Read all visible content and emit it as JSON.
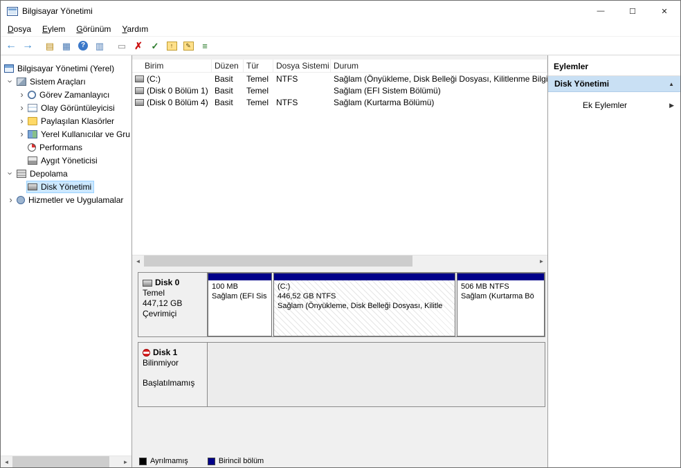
{
  "window": {
    "title": "Bilgisayar Yönetimi",
    "controls": {
      "minimize": "—",
      "maximize": "☐",
      "close": "✕"
    }
  },
  "menu": {
    "items": [
      {
        "label": "Dosya"
      },
      {
        "label": "Eylem"
      },
      {
        "label": "Görünüm"
      },
      {
        "label": "Yardım"
      }
    ]
  },
  "toolbar": {
    "icons": [
      {
        "name": "back",
        "glyph": "←"
      },
      {
        "name": "forward",
        "glyph": "→"
      },
      {
        "name": "show-console-tree",
        "glyph": "▤"
      },
      {
        "name": "export-list",
        "glyph": "▦"
      },
      {
        "name": "help",
        "glyph": "?"
      },
      {
        "name": "show-action-pane",
        "glyph": "▥"
      },
      {
        "name": "status-popup",
        "glyph": "▭"
      },
      {
        "name": "delete-volume",
        "glyph": "✗"
      },
      {
        "name": "mark-active",
        "glyph": "✓"
      },
      {
        "name": "open",
        "glyph": "↑"
      },
      {
        "name": "explore",
        "glyph": "✎"
      },
      {
        "name": "properties",
        "glyph": "≡"
      }
    ]
  },
  "tree": {
    "items": [
      {
        "label": "Bilgisayar Yönetimi (Yerel)"
      },
      {
        "label": "Sistem Araçları"
      },
      {
        "label": "Görev Zamanlayıcı"
      },
      {
        "label": "Olay Görüntüleyicisi"
      },
      {
        "label": "Paylaşılan Klasörler"
      },
      {
        "label": "Yerel Kullanıcılar ve Gru"
      },
      {
        "label": "Performans"
      },
      {
        "label": "Aygıt Yöneticisi"
      },
      {
        "label": "Depolama"
      },
      {
        "label": "Disk Yönetimi"
      },
      {
        "label": "Hizmetler ve Uygulamalar"
      }
    ]
  },
  "volume_table": {
    "columns": [
      "Birim",
      "Düzen",
      "Tür",
      "Dosya Sistemi",
      "Durum"
    ],
    "rows": [
      {
        "name": "(C:)",
        "layout": "Basit",
        "type": "Temel",
        "fs": "NTFS",
        "status": "Sağlam (Önyükleme, Disk Belleği Dosyası, Kilitlenme Bilgis"
      },
      {
        "name": "(Disk 0 Bölüm 1)",
        "layout": "Basit",
        "type": "Temel",
        "fs": "",
        "status": "Sağlam (EFI Sistem Bölümü)"
      },
      {
        "name": "(Disk 0 Bölüm 4)",
        "layout": "Basit",
        "type": "Temel",
        "fs": "NTFS",
        "status": "Sağlam (Kurtarma Bölümü)"
      }
    ]
  },
  "disk0": {
    "name": "Disk 0",
    "type": "Temel",
    "size": "447,12 GB",
    "status": "Çevrimiçi",
    "partitions": [
      {
        "title": "",
        "size": "100 MB",
        "status": "Sağlam (EFI Sis"
      },
      {
        "title": "(C:)",
        "size": "446,52 GB NTFS",
        "status": "Sağlam (Önyükleme, Disk Belleği Dosyası, Kilitle"
      },
      {
        "title": "",
        "size": "506 MB NTFS",
        "status": "Sağlam (Kurtarma Bö"
      }
    ]
  },
  "disk1": {
    "name": "Disk 1",
    "type": "Bilinmiyor",
    "status": "Başlatılmamış"
  },
  "legend": [
    {
      "label": "Ayrılmamış",
      "color": "#000000"
    },
    {
      "label": "Birincil bölüm",
      "color": "#000089"
    }
  ],
  "actions": {
    "title": "Eylemler",
    "header": "Disk Yönetimi",
    "more": "Ek Eylemler"
  },
  "icons": {
    "scroll_left": "◄",
    "scroll_right": "►",
    "collapse": "▲",
    "expand": "▶"
  },
  "colors": {
    "primary_partition": "#000089",
    "unallocated": "#000000",
    "tree_selection": "#cce8ff",
    "action_header_bg": "#c9e0f4"
  }
}
